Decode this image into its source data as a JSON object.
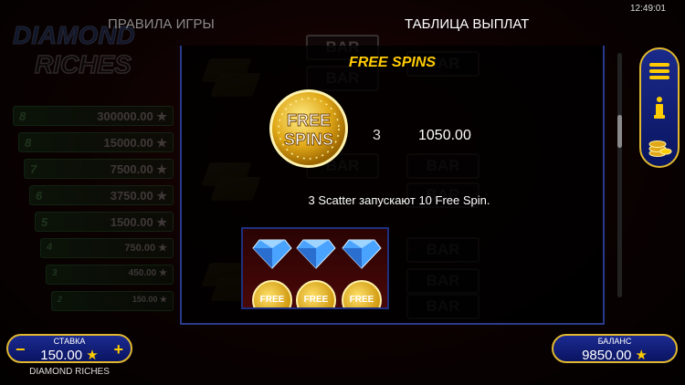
{
  "clock": "12:49:01",
  "tabs": {
    "rules": "ПРАВИЛА ИГРЫ",
    "payouts": "ТАБЛИЦА ВЫПЛАТ"
  },
  "background": {
    "logo_line1": "DIAMOND",
    "logo_line2": "RICHES",
    "paytable": [
      {
        "level": "8",
        "amount": "300000.00"
      },
      {
        "level": "8",
        "amount": "15000.00"
      },
      {
        "level": "7",
        "amount": "7500.00"
      },
      {
        "level": "6",
        "amount": "3750.00"
      },
      {
        "level": "5",
        "amount": "1500.00"
      },
      {
        "level": "4",
        "amount": "750.00"
      },
      {
        "level": "3",
        "amount": "450.00"
      },
      {
        "level": "2",
        "amount": "150.00"
      }
    ],
    "bar_label": "BAR"
  },
  "section": {
    "title": "FREE SPINS",
    "coin_line1": "FREE",
    "coin_line2": "SPINS",
    "combo_count": "3",
    "combo_payout": "1050.00",
    "description": "3 Scatter запускают 10 Free Spin.",
    "mini_coin_label": "FREE"
  },
  "bet": {
    "label": "СТАВКА",
    "value": "150.00",
    "minus": "−",
    "plus": "+"
  },
  "balance": {
    "label": "БАЛАНС",
    "value": "9850.00"
  },
  "game_name": "DIAMOND RICHES",
  "colors": {
    "accent_gold": "#ffcc00",
    "pill_blue": "#1b2a90",
    "border_gold": "#e0b830"
  },
  "icons": {
    "menu": "hamburger-icon",
    "info": "info-icon",
    "coins": "coins-icon"
  }
}
